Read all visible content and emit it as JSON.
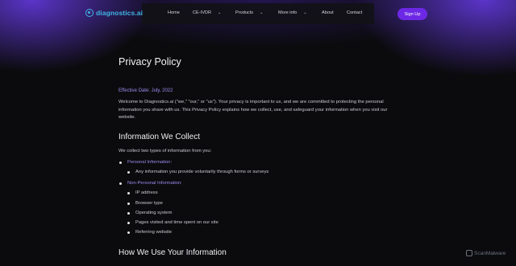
{
  "nav": {
    "logo_text": "diagnostics.ai",
    "items": [
      {
        "label": "Home",
        "has_dropdown": false
      },
      {
        "label": "CE-IVDR",
        "has_dropdown": true
      },
      {
        "label": "Products",
        "has_dropdown": true
      },
      {
        "label": "More info",
        "has_dropdown": true
      },
      {
        "label": "About",
        "has_dropdown": false
      },
      {
        "label": "Contact",
        "has_dropdown": false
      }
    ],
    "signup_label": "Sign Up"
  },
  "page": {
    "title": "Privacy Policy",
    "effective_date": "Effective Date: July, 2022",
    "intro": "Welcome to Diagnostics.ai (\"we,\" \"our,\" or \"us\"). Your privacy is important to us, and we are committed to protecting the personal information you share with us. This Privacy Policy explains how we collect, use, and safeguard your information when you visit our website.",
    "section1": {
      "heading": "Information We Collect",
      "lead": "We collect two types of information from you:",
      "categories": [
        {
          "label": "Personal Information:",
          "items": [
            "Any information you provide voluntarily through forms or surveys"
          ]
        },
        {
          "label": "Non-Personal Information:",
          "items": [
            "IP address",
            "Browser type",
            "Operating system",
            "Pages visited and time spent on our site",
            "Referring website"
          ]
        }
      ]
    },
    "section2": {
      "heading": "How We Use Your Information"
    }
  },
  "watermark": "ScanMalware",
  "colors": {
    "accent": "#6d28e6",
    "link": "#9b8cf0",
    "logo": "#3fb6e6",
    "background": "#0b0b0d"
  }
}
